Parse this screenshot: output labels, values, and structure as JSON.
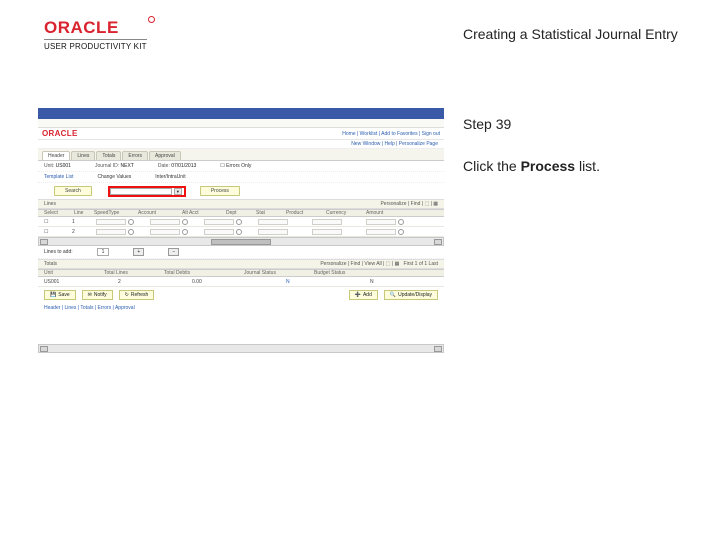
{
  "header": {
    "brand": "ORACLE",
    "subline": "USER PRODUCTIVITY KIT"
  },
  "title": "Creating a Statistical Journal Entry",
  "step_label": "Step 39",
  "instruction_pre": "Click the ",
  "instruction_bold": "Process",
  "instruction_post": " list.",
  "shot": {
    "oracle": "ORACLE",
    "nav_links": "New Window | Help | Personalize Page",
    "tabs": [
      "Header",
      "Lines",
      "Totals",
      "Errors",
      "Approval"
    ],
    "form": {
      "unit_label": "Unit:",
      "unit_val": "US001",
      "journal_label": "Journal ID:",
      "journal_val": "NEXT",
      "date_label": "Date:",
      "date_val": "07/01/2013",
      "errors_label": "Errors Only",
      "template_label": "Template List",
      "change_label": "Change Values",
      "intra_label": "Inter/IntraUnit",
      "search_btn": "Search",
      "process_btn": "Process",
      "process_field": " "
    },
    "grid": {
      "section": "Lines",
      "cols": [
        "Select",
        "Line",
        "SpeedType",
        "Account",
        "Alt Acct",
        "Dept",
        "Stat",
        "Product",
        "Currency",
        "Amount"
      ],
      "row1": [
        "1"
      ],
      "row2": [
        "2"
      ]
    },
    "totals": {
      "section": "Lines to add:",
      "value": "1"
    },
    "totals2": {
      "label": "Totals",
      "unit": "Unit",
      "total_lines": "Total Lines",
      "total_debits": "Total Debits",
      "journal_status": "Journal Status",
      "budget_status": "Budget Status"
    },
    "totals_row": {
      "unit": "US001",
      "lines": "2",
      "debits": "0.00",
      "jstatus": "N",
      "bstatus": "N"
    },
    "bottom": {
      "save": "Save",
      "notify": "Notify",
      "refresh": "Refresh",
      "add": "Add",
      "update": "Update/Display"
    },
    "crumbs": "Header | Lines | Totals | Errors | Approval"
  }
}
